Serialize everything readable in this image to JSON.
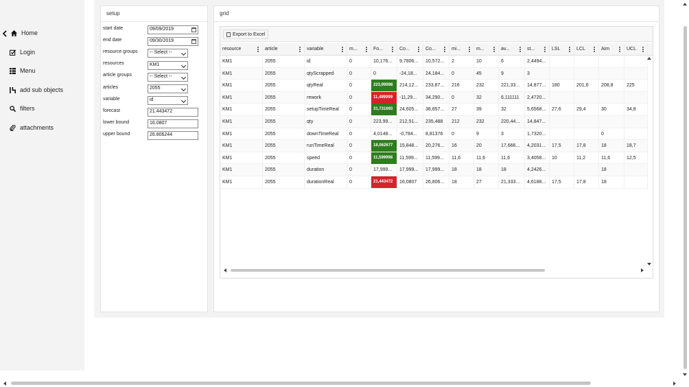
{
  "sidebar": {
    "items": [
      {
        "label": "Home",
        "icon": "home-icon"
      },
      {
        "label": "Login",
        "icon": "login-icon"
      },
      {
        "label": "Menu",
        "icon": "menu-icon"
      },
      {
        "label": "add sub objects",
        "icon": "add-sub-objects-icon"
      },
      {
        "label": "filters",
        "icon": "search-icon"
      },
      {
        "label": "attachments",
        "icon": "paperclip-icon"
      }
    ]
  },
  "setup": {
    "title": "setup",
    "start_date_label": "start date",
    "start_date": "09/09/2019",
    "end_date_label": "end date",
    "end_date": "09/30/2019",
    "resource_groups_label": "resource groups",
    "resource_groups_value": "-- Select --",
    "resources_label": "resources",
    "resources_value": "KM1",
    "article_groups_label": "article groups",
    "article_groups_value": "-- Select --",
    "articles_label": "articles",
    "articles_value": "2055",
    "variable_label": "variable",
    "variable_value": "id",
    "forecast_label": "forecast",
    "forecast_value": "21.443472",
    "lower_bound_label": "lower bound",
    "lower_bound_value": "16.0807",
    "upper_bound_label": "upper bound",
    "upper_bound_value": "26.806244"
  },
  "grid": {
    "title": "grid",
    "export_label": "Export to Excel",
    "columns": [
      "resource",
      "article",
      "variable",
      "m...",
      "Fo...",
      "Co...",
      "Co...",
      "mi...",
      "m...",
      "av...",
      "st...",
      "LSL",
      "LCL",
      "Aim",
      "UCL"
    ],
    "rows": [
      [
        "KM1",
        "2055",
        "id",
        "0",
        "10,176...",
        "9,7806...",
        "10,572...",
        "2",
        "10",
        "6",
        "2,4494...",
        "",
        "",
        "",
        ""
      ],
      [
        "KM1",
        "2055",
        "qtyScrapped",
        "0",
        "0",
        "-24,18...",
        "24,184...",
        "0",
        "45",
        "9",
        "3",
        "",
        "",
        "",
        ""
      ],
      [
        "KM1",
        "2055",
        "qtyReal",
        "0",
        "223,99998",
        "214,12...",
        "233,87...",
        "216",
        "232",
        "221,33...",
        "14,877...",
        "180",
        "201,6",
        "208,8",
        "225"
      ],
      [
        "KM1",
        "2055",
        "rework",
        "0",
        "11,499999",
        "-11,29...",
        "34,290...",
        "0",
        "32",
        "6,111111",
        "2,4720...",
        "",
        "",
        "",
        ""
      ],
      [
        "KM1",
        "2055",
        "setupTimeReal",
        "0",
        "31,731693",
        "24,605...",
        "38,857...",
        "27",
        "39",
        "32",
        "5,6568...",
        "27,6",
        "29,4",
        "30",
        "34,8"
      ],
      [
        "KM1",
        "2055",
        "qty",
        "0",
        "223,99...",
        "212,51...",
        "235,488",
        "212",
        "232",
        "220,44...",
        "14,847...",
        "",
        "",
        "",
        ""
      ],
      [
        "KM1",
        "2055",
        "downTimeReal",
        "0",
        "4,0148...",
        "-0,784...",
        "8,81376",
        "0",
        "9",
        "3",
        "1,7320...",
        "",
        "",
        "0",
        ""
      ],
      [
        "KM1",
        "2055",
        "runTimeReal",
        "0",
        "18,062677",
        "15,848...",
        "20,276...",
        "16",
        "20",
        "17,666...",
        "4,2031...",
        "17,5",
        "17,8",
        "18",
        "18,7"
      ],
      [
        "KM1",
        "2055",
        "speed",
        "0",
        "11,599998",
        "11,599...",
        "11,599...",
        "11,6",
        "11,6",
        "11,6",
        "3,4058...",
        "10",
        "11,2",
        "11,6",
        "12,5"
      ],
      [
        "KM1",
        "2055",
        "duration",
        "0",
        "17,999...",
        "17,999...",
        "17,999...",
        "18",
        "18",
        "18",
        "4,2426...",
        "",
        "",
        "18",
        ""
      ],
      [
        "KM1",
        "2055",
        "durationReal",
        "0",
        "21,443472",
        "16,0807",
        "26,806...",
        "18",
        "27",
        "21,333...",
        "4,6188...",
        "17,5",
        "17,8",
        "18",
        ""
      ]
    ],
    "forecast_highlights": [
      "none",
      "none",
      "green",
      "red",
      "green",
      "none",
      "none",
      "green",
      "green",
      "none",
      "red"
    ]
  },
  "colors": {
    "highlight_green": "#2e7d1e",
    "highlight_red": "#d3242c",
    "panel_bg": "#f3f3f3"
  }
}
